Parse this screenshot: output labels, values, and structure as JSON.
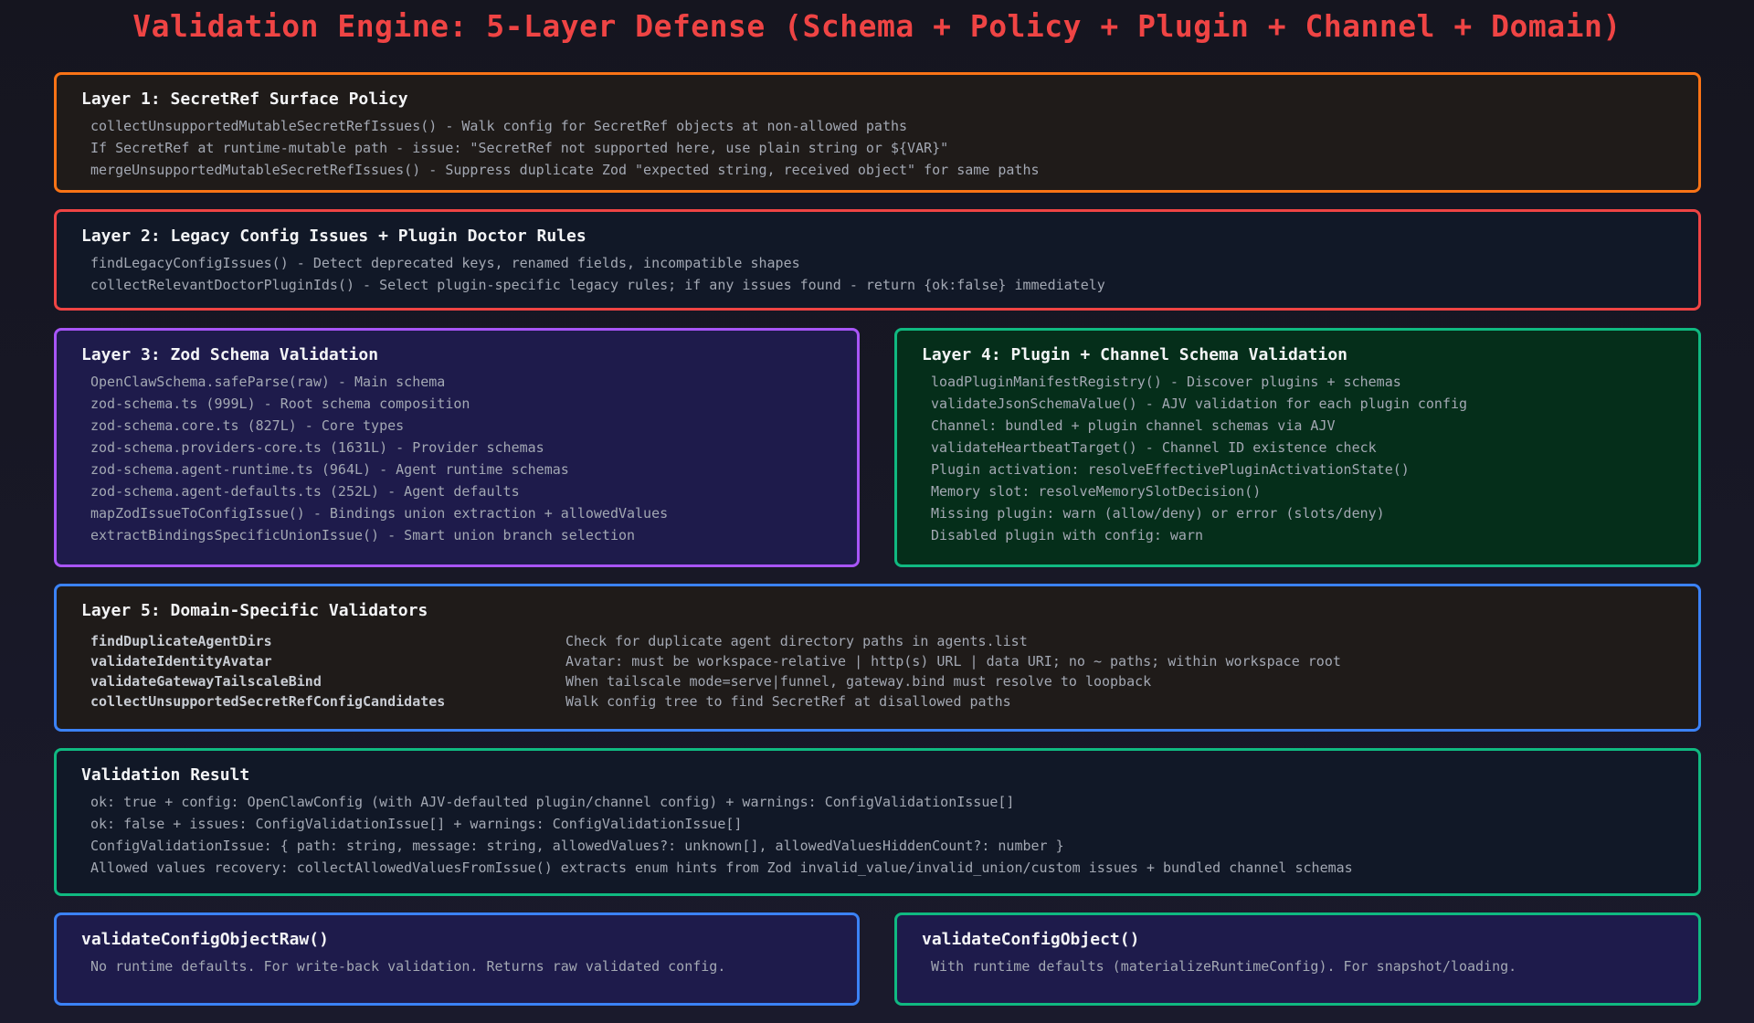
{
  "title": "Validation Engine: 5-Layer Defense (Schema + Policy + Plugin + Channel + Domain)",
  "colors": {
    "title": "#ef4444",
    "layer1_border": "#f97316",
    "layer2_border": "#ef4444",
    "layer3_border": "#a855f7",
    "layer4_border": "#10b981",
    "layer5_border": "#3b82f6",
    "result_border": "#10b981"
  },
  "layer1": {
    "title": "Layer 1: SecretRef Surface Policy",
    "lines": [
      "collectUnsupportedMutableSecretRefIssues() - Walk config for SecretRef objects at non-allowed paths",
      "If SecretRef at runtime-mutable path - issue: \"SecretRef not supported here, use plain string or ${VAR}\"",
      "mergeUnsupportedMutableSecretRefIssues() - Suppress duplicate Zod \"expected string, received object\" for same paths"
    ]
  },
  "layer2": {
    "title": "Layer 2: Legacy Config Issues + Plugin Doctor Rules",
    "lines": [
      "findLegacyConfigIssues() - Detect deprecated keys, renamed fields, incompatible shapes",
      "collectRelevantDoctorPluginIds() - Select plugin-specific legacy rules; if any issues found - return {ok:false} immediately"
    ]
  },
  "layer3": {
    "title": "Layer 3: Zod Schema Validation",
    "lines": [
      "OpenClawSchema.safeParse(raw) - Main schema",
      "zod-schema.ts (999L) - Root schema composition",
      "zod-schema.core.ts (827L) - Core types",
      "zod-schema.providers-core.ts (1631L) - Provider schemas",
      "zod-schema.agent-runtime.ts (964L) - Agent runtime schemas",
      "zod-schema.agent-defaults.ts (252L) - Agent defaults",
      "mapZodIssueToConfigIssue() - Bindings union extraction + allowedValues",
      "extractBindingsSpecificUnionIssue() - Smart union branch selection"
    ]
  },
  "layer4": {
    "title": "Layer 4: Plugin + Channel Schema Validation",
    "lines": [
      "loadPluginManifestRegistry() - Discover plugins + schemas",
      "validateJsonSchemaValue() - AJV validation for each plugin config",
      "Channel: bundled + plugin channel schemas via AJV",
      "validateHeartbeatTarget() - Channel ID existence check",
      "Plugin activation: resolveEffectivePluginActivationState()",
      "Memory slot: resolveMemorySlotDecision()",
      "Missing plugin: warn (allow/deny) or error (slots/deny)",
      "Disabled plugin with config: warn"
    ]
  },
  "layer5": {
    "title": "Layer 5: Domain-Specific Validators",
    "rows": [
      {
        "fn": "findDuplicateAgentDirs",
        "desc": "Check for duplicate agent directory paths in agents.list"
      },
      {
        "fn": "validateIdentityAvatar",
        "desc": "Avatar: must be workspace-relative | http(s) URL | data URI; no ~ paths; within workspace root"
      },
      {
        "fn": "validateGatewayTailscaleBind",
        "desc": "When tailscale mode=serve|funnel, gateway.bind must resolve to loopback"
      },
      {
        "fn": "collectUnsupportedSecretRefConfigCandidates",
        "desc": "Walk config tree to find SecretRef at disallowed paths"
      }
    ]
  },
  "result": {
    "title": "Validation Result",
    "lines": [
      "ok: true + config: OpenClawConfig (with AJV-defaulted plugin/channel config) + warnings: ConfigValidationIssue[]",
      "ok: false + issues: ConfigValidationIssue[] + warnings: ConfigValidationIssue[]",
      "ConfigValidationIssue: { path: string, message: string, allowedValues?: unknown[], allowedValuesHiddenCount?: number }",
      "Allowed values recovery: collectAllowedValuesFromIssue() extracts enum hints from Zod invalid_value/invalid_union/custom issues + bundled channel schemas"
    ]
  },
  "raw_box": {
    "title": "validateConfigObjectRaw()",
    "lines": [
      "No runtime defaults. For write-back validation. Returns raw validated config."
    ]
  },
  "obj_box": {
    "title": "validateConfigObject()",
    "lines": [
      "With runtime defaults (materializeRuntimeConfig). For snapshot/loading."
    ]
  }
}
